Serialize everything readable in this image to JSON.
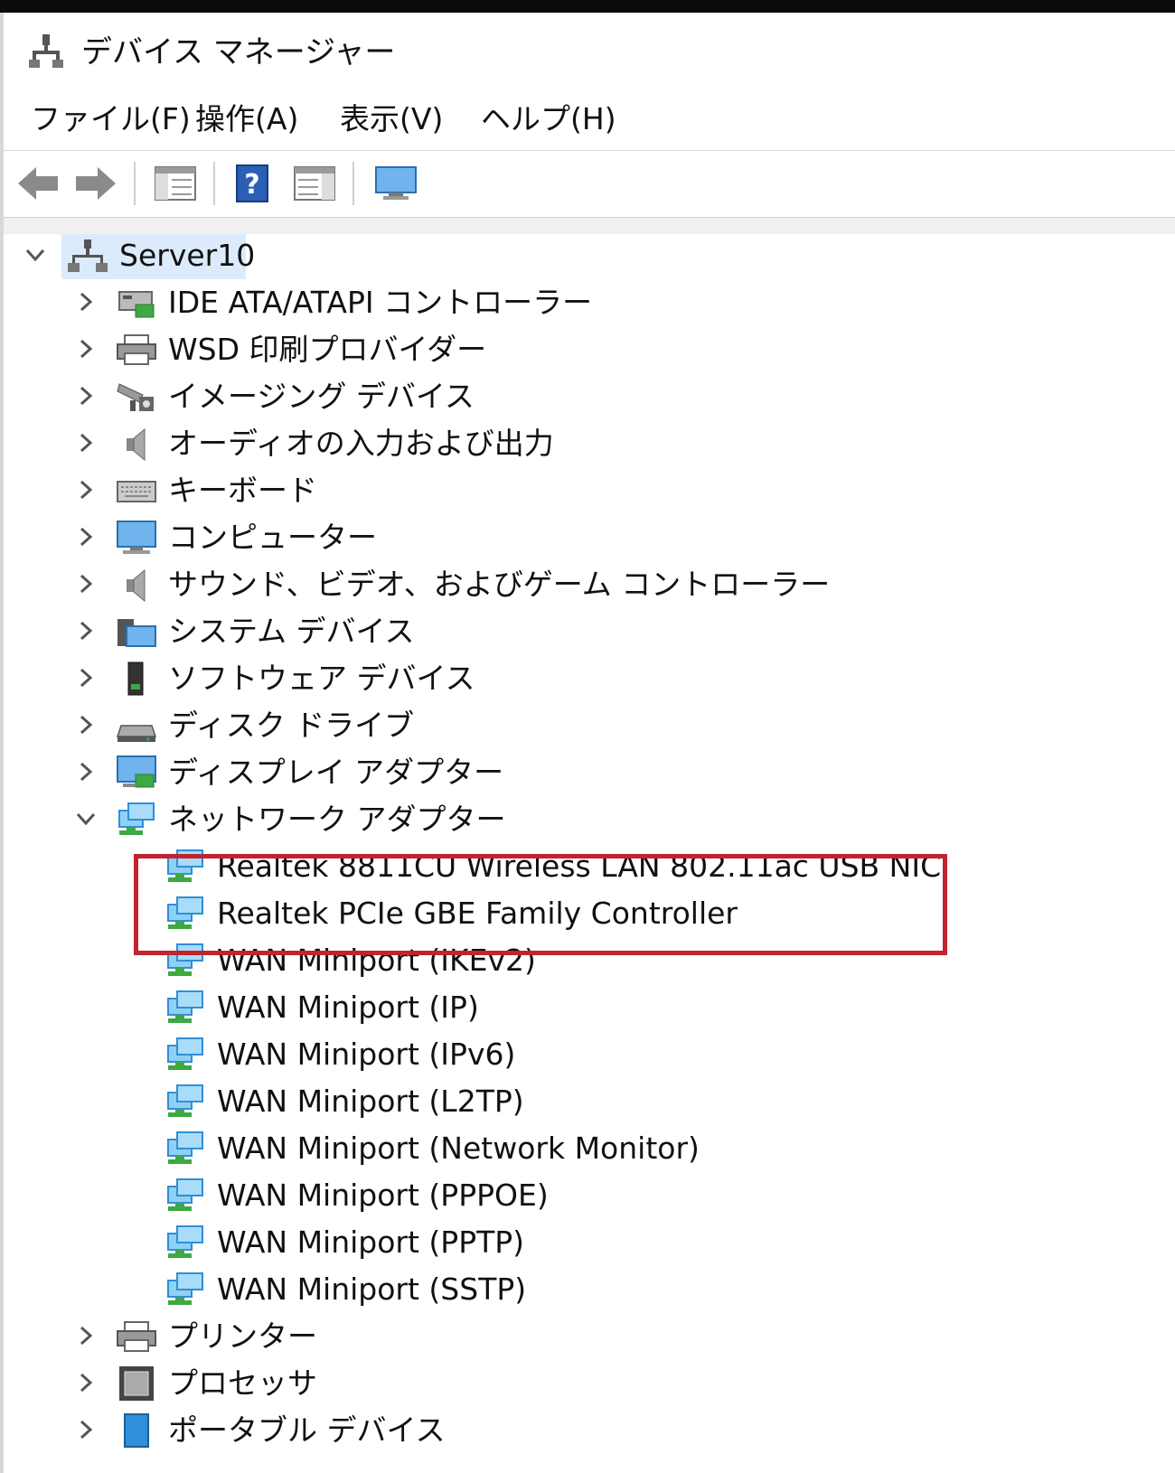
{
  "window": {
    "title": "デバイス マネージャー"
  },
  "menu": [
    {
      "label": "ファイル(F)"
    },
    {
      "label": "操作(A)"
    },
    {
      "label": "表示(V)"
    },
    {
      "label": "ヘルプ(H)"
    }
  ],
  "toolbar": {
    "icons": [
      "back-arrow-icon",
      "forward-arrow-icon",
      "show-hide-console-tree-icon",
      "help-icon",
      "properties-pane-icon",
      "monitor-icon"
    ]
  },
  "tree": {
    "root": {
      "label": "Server10",
      "expanded": true
    },
    "categories": [
      {
        "label": "IDE ATA/ATAPI コントローラー",
        "icon": "ide-controller-icon"
      },
      {
        "label": "WSD 印刷プロバイダー",
        "icon": "printer-icon"
      },
      {
        "label": "イメージング デバイス",
        "icon": "camera-icon"
      },
      {
        "label": "オーディオの入力および出力",
        "icon": "speaker-icon"
      },
      {
        "label": "キーボード",
        "icon": "keyboard-icon"
      },
      {
        "label": "コンピューター",
        "icon": "computer-monitor-icon"
      },
      {
        "label": "サウンド、ビデオ、およびゲーム コントローラー",
        "icon": "speaker-icon"
      },
      {
        "label": "システム デバイス",
        "icon": "system-folder-icon"
      },
      {
        "label": "ソフトウェア デバイス",
        "icon": "software-device-icon"
      },
      {
        "label": "ディスク ドライブ",
        "icon": "disk-drive-icon"
      },
      {
        "label": "ディスプレイ アダプター",
        "icon": "display-adapter-icon"
      },
      {
        "label": "ネットワーク アダプター",
        "icon": "network-adapter-icon",
        "expanded": true
      }
    ],
    "network_adapters": [
      {
        "label": "Realtek 8811CU Wireless LAN 802.11ac USB NIC"
      },
      {
        "label": "Realtek PCIe GBE Family Controller"
      },
      {
        "label": "WAN Miniport (IKEv2)"
      },
      {
        "label": "WAN Miniport (IP)"
      },
      {
        "label": "WAN Miniport (IPv6)"
      },
      {
        "label": "WAN Miniport (L2TP)"
      },
      {
        "label": "WAN Miniport (Network Monitor)"
      },
      {
        "label": "WAN Miniport (PPPOE)"
      },
      {
        "label": "WAN Miniport (PPTP)"
      },
      {
        "label": "WAN Miniport (SSTP)"
      }
    ],
    "after": [
      {
        "label": "プリンター",
        "icon": "printer-icon"
      },
      {
        "label": "プロセッサ",
        "icon": "processor-icon"
      },
      {
        "label": "ポータブル デバイス",
        "icon": "portable-device-icon"
      }
    ]
  },
  "colors": {
    "selection": "#dcebfc",
    "highlight_border": "#c0242f",
    "network_icon_blue": "#2f8fd8",
    "network_icon_green": "#3da844"
  }
}
